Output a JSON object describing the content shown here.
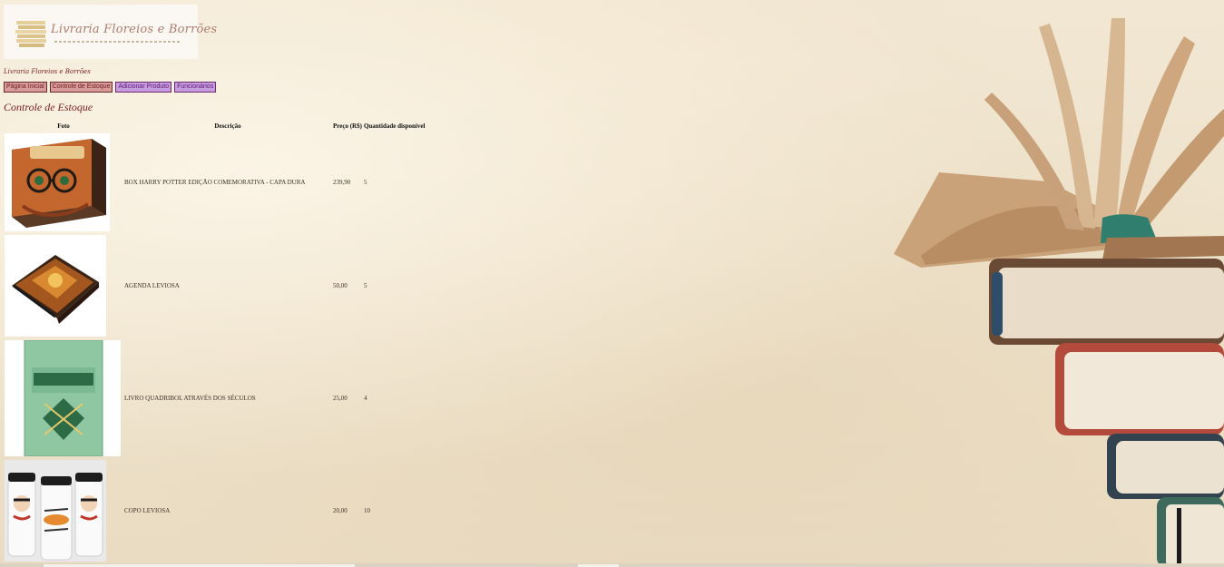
{
  "logo": {
    "title": "Livraria Floreios e Borrões"
  },
  "store_name": "Livraria Floreios e Borrões",
  "nav": {
    "items": [
      {
        "label": "Página Inicial"
      },
      {
        "label": "Controle de Estoque"
      },
      {
        "label": "Adicionar Produto"
      },
      {
        "label": "Funcionários"
      }
    ]
  },
  "page_title": "Controle de Estoque",
  "table": {
    "headers": {
      "photo": "Foto",
      "description": "Descrição",
      "price": "Preço (R$)",
      "quantity": "Quantidade disponível"
    },
    "rows": [
      {
        "description": "BOX HARRY POTTER EDIÇÃO COMEMORATIVA - CAPA DURA",
        "price": "239,90",
        "quantity": "5",
        "photo_icon": "harry-potter-box-image"
      },
      {
        "description": "AGENDA LEVIOSA",
        "price": "50,00",
        "quantity": "5",
        "photo_icon": "agenda-image"
      },
      {
        "description": "LIVRO QUADRIBOL ATRAVÉS DOS SÉCULOS",
        "price": "25,00",
        "quantity": "4",
        "photo_icon": "quadribol-book-image"
      },
      {
        "description": "COPO LEVIOSA",
        "price": "20,00",
        "quantity": "10",
        "photo_icon": "cups-image"
      }
    ]
  },
  "colors": {
    "accent": "#7a1d1d",
    "nav_pink": "#d99a9a",
    "nav_purple": "#c79be0",
    "background": "#efe4cf"
  }
}
